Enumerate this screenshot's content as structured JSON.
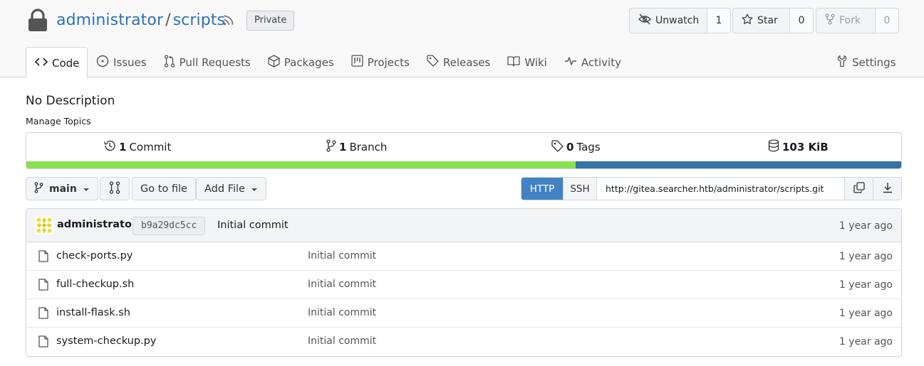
{
  "repo": {
    "owner": "administrator",
    "separator": "/",
    "name": "scripts",
    "visibility": "Private"
  },
  "actions": {
    "watch": {
      "label": "Unwatch",
      "count": "1"
    },
    "star": {
      "label": "Star",
      "count": "0"
    },
    "fork": {
      "label": "Fork",
      "count": "0"
    }
  },
  "tabs": [
    {
      "label": "Code",
      "icon": "code-icon"
    },
    {
      "label": "Issues",
      "icon": "issue-icon"
    },
    {
      "label": "Pull Requests",
      "icon": "pull-request-icon"
    },
    {
      "label": "Packages",
      "icon": "package-icon"
    },
    {
      "label": "Projects",
      "icon": "project-icon"
    },
    {
      "label": "Releases",
      "icon": "tag-icon"
    },
    {
      "label": "Wiki",
      "icon": "book-icon"
    },
    {
      "label": "Activity",
      "icon": "pulse-icon"
    }
  ],
  "settings_label": "Settings",
  "description": "No Description",
  "manage_topics": "Manage Topics",
  "stats": {
    "commits": {
      "count": "1",
      "label": "Commit"
    },
    "branches": {
      "count": "1",
      "label": "Branch"
    },
    "tags": {
      "count": "0",
      "label": "Tags"
    },
    "size": {
      "count": "103 KiB"
    }
  },
  "languages": [
    {
      "color": "#89e051",
      "fraction": 0.628
    },
    {
      "color": "#3572a5",
      "fraction": 0.372
    }
  ],
  "branch": "main",
  "goto_file": "Go to file",
  "add_file": "Add File",
  "clone": {
    "http": "HTTP",
    "ssh": "SSH",
    "url": "http://gitea.searcher.htb/administrator/scripts.git"
  },
  "latest_commit": {
    "author": "administrator",
    "sha": "b9a29dc5cc",
    "message": "Initial commit",
    "age": "1 year ago"
  },
  "files": [
    {
      "name": "check-ports.py",
      "message": "Initial commit",
      "age": "1 year ago"
    },
    {
      "name": "full-checkup.sh",
      "message": "Initial commit",
      "age": "1 year ago"
    },
    {
      "name": "install-flask.sh",
      "message": "Initial commit",
      "age": "1 year ago"
    },
    {
      "name": "system-checkup.py",
      "message": "Initial commit",
      "age": "1 year ago"
    }
  ]
}
